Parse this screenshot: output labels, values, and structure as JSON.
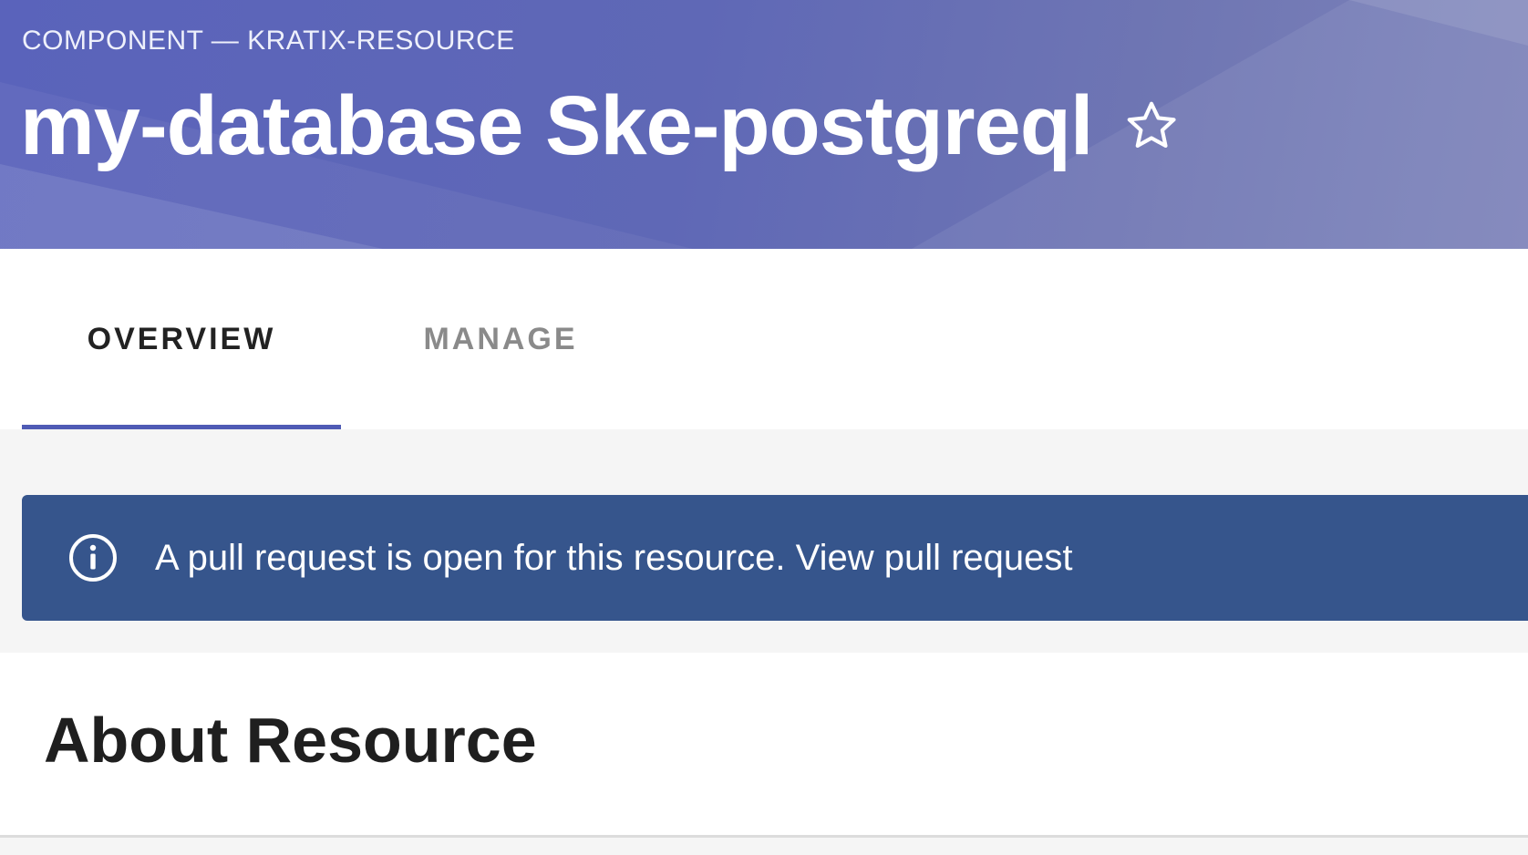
{
  "header": {
    "kind_label": "COMPONENT — KRATIX-RESOURCE",
    "title": "my-database Ske-postgreql",
    "favorite_icon": "star-outline-icon"
  },
  "tabs": [
    {
      "label": "OVERVIEW",
      "selected": true
    },
    {
      "label": "MANAGE",
      "selected": false
    }
  ],
  "banner": {
    "icon": "info-icon",
    "message": "A pull request is open for this resource.",
    "link_label": "View pull request"
  },
  "about": {
    "title": "About Resource"
  },
  "colors": {
    "header_bg": "#5f68b6",
    "tab_indicator": "#4f5bb5",
    "banner_bg": "#36558c"
  }
}
